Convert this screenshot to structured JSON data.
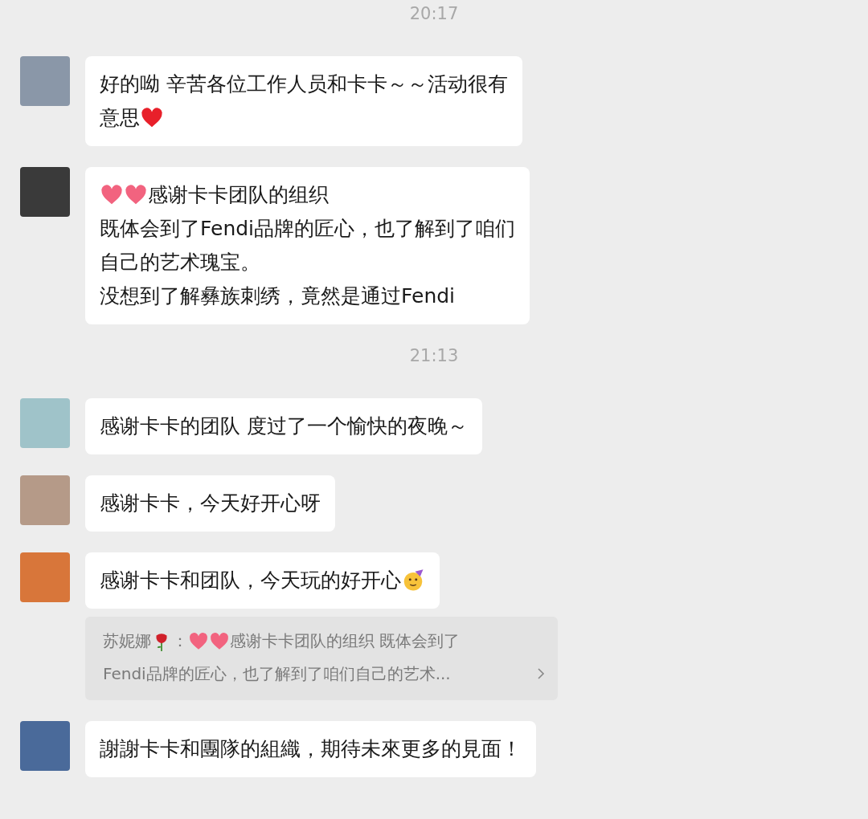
{
  "items": [
    {
      "kind": "time",
      "text": "20:17"
    },
    {
      "kind": "message",
      "lines": [
        [
          {
            "kind": "text",
            "text": "好的呦 辛苦各位工作人员和卡卡～～活动很有"
          }
        ],
        [
          {
            "kind": "text",
            "text": "意思"
          },
          {
            "kind": "red_heart"
          }
        ]
      ]
    },
    {
      "kind": "message",
      "lines": [
        [
          {
            "kind": "pink_heart"
          },
          {
            "kind": "pink_heart"
          },
          {
            "kind": "text",
            "text": "感谢卡卡团队的组织"
          }
        ],
        [
          {
            "kind": "text",
            "text": "既体会到了Fendi品牌的匠心，也了解到了咱们"
          }
        ],
        [
          {
            "kind": "text",
            "text": "自己的艺术瑰宝。"
          }
        ],
        [
          {
            "kind": "text",
            "text": "没想到了解彝族刺绣，竟然是通过Fendi"
          }
        ]
      ]
    },
    {
      "kind": "time",
      "text": "21:13"
    },
    {
      "kind": "message",
      "lines": [
        [
          {
            "kind": "text",
            "text": "感谢卡卡的团队 度过了一个愉快的夜晚～"
          }
        ]
      ]
    },
    {
      "kind": "message",
      "lines": [
        [
          {
            "kind": "text",
            "text": "感谢卡卡，今天好开心呀"
          }
        ]
      ]
    },
    {
      "kind": "message",
      "lines": [
        [
          {
            "kind": "text",
            "text": "感谢卡卡和团队，今天玩的好开心"
          },
          {
            "kind": "party_face"
          }
        ]
      ],
      "quote": {
        "lines": [
          [
            {
              "kind": "text",
              "text": "苏妮娜"
            },
            {
              "kind": "rose"
            },
            {
              "kind": "text",
              "text": "："
            },
            {
              "kind": "pink_heart"
            },
            {
              "kind": "pink_heart"
            },
            {
              "kind": "text",
              "text": "感谢卡卡团队的组织 既体会到了"
            }
          ],
          [
            {
              "kind": "text",
              "text": "Fendi品牌的匠心，也了解到了咱们自己的艺术..."
            }
          ]
        ]
      }
    },
    {
      "kind": "message",
      "lines": [
        [
          {
            "kind": "text",
            "text": "謝謝卡卡和團隊的組織，期待未來更多的見面！"
          }
        ]
      ]
    }
  ]
}
